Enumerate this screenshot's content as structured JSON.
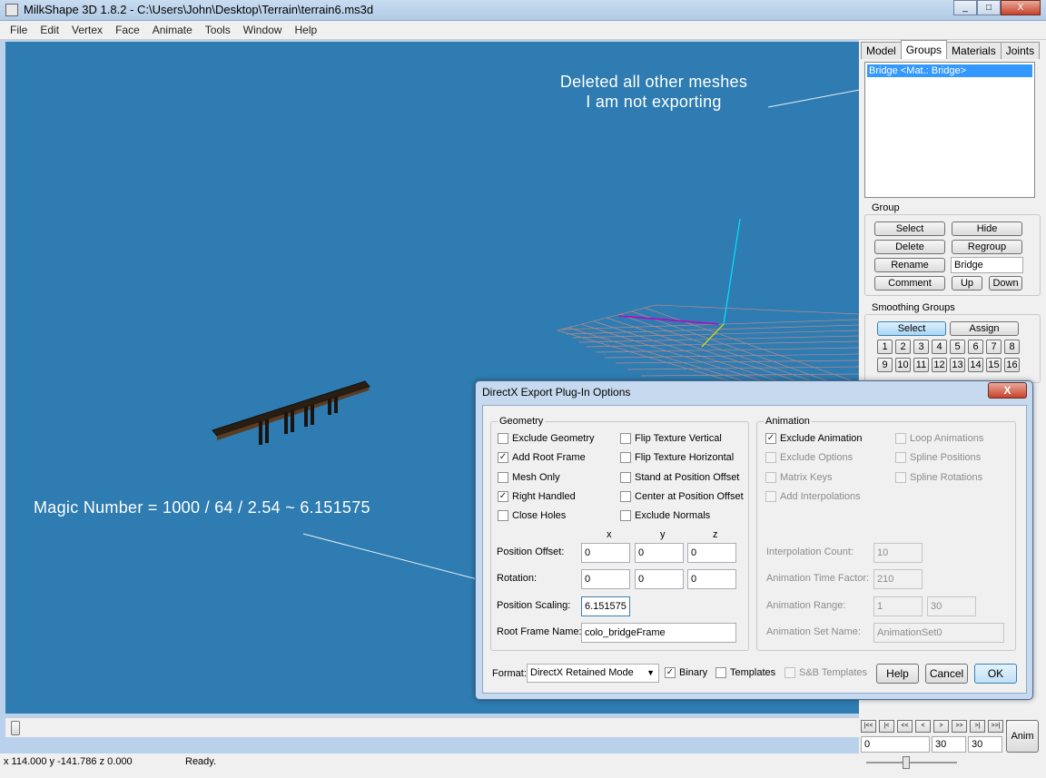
{
  "window": {
    "title": "MilkShape 3D 1.8.2 - C:\\Users\\John\\Desktop\\Terrain\\terrain6.ms3d",
    "buttons": [
      "_",
      "□",
      "X"
    ]
  },
  "menu": [
    "File",
    "Edit",
    "Vertex",
    "Face",
    "Animate",
    "Tools",
    "Window",
    "Help"
  ],
  "viewport": {
    "annotation_top": [
      "Deleted all other meshes",
      "I am not exporting"
    ],
    "annotation_left": "Magic Number = 1000 / 64 / 2.54 ~ 6.151575"
  },
  "right_panel": {
    "tabs": [
      "Model",
      "Groups",
      "Materials",
      "Joints"
    ],
    "active_tab": "Groups",
    "group_list": [
      "Bridge <Mat.: Bridge>"
    ],
    "group": {
      "title": "Group",
      "select": "Select",
      "hide": "Hide",
      "delete": "Delete",
      "regroup": "Regroup",
      "rename": "Rename",
      "name_value": "Bridge",
      "comment": "Comment",
      "up": "Up",
      "down": "Down"
    },
    "smoothing": {
      "title": "Smoothing Groups",
      "select": "Select",
      "assign": "Assign",
      "numbers": [
        "1",
        "2",
        "3",
        "4",
        "5",
        "6",
        "7",
        "8",
        "9",
        "10",
        "11",
        "12",
        "13",
        "14",
        "15",
        "16"
      ]
    }
  },
  "status": {
    "coords": "x 114.000 y -141.786 z 0.000",
    "message": "Ready."
  },
  "anim_controls": {
    "nav": [
      "|<<",
      "|<",
      "<<",
      "<",
      ">",
      ">>",
      ">|",
      ">>|",
      "||"
    ],
    "anim_button": "Anim",
    "frame": "0",
    "start": "30",
    "end": "30"
  },
  "dialog": {
    "title": "DirectX Export Plug-In Options",
    "close": "X",
    "geometry": {
      "title": "Geometry",
      "checks_left": [
        {
          "label": "Exclude Geometry",
          "checked": false
        },
        {
          "label": "Add Root Frame",
          "checked": true
        },
        {
          "label": "Mesh Only",
          "checked": false
        },
        {
          "label": "Right Handled",
          "checked": true
        },
        {
          "label": "Close Holes",
          "checked": false
        }
      ],
      "checks_right": [
        {
          "label": "Flip Texture Vertical",
          "checked": false
        },
        {
          "label": "Flip Texture Horizontal",
          "checked": false
        },
        {
          "label": "Stand at Position Offset",
          "checked": false
        },
        {
          "label": "Center at Position Offset",
          "checked": false
        },
        {
          "label": "Exclude Normals",
          "checked": false
        }
      ],
      "axis_x": "x",
      "axis_y": "y",
      "axis_z": "z",
      "position_offset_label": "Position Offset:",
      "position_offset": [
        "0",
        "0",
        "0"
      ],
      "rotation_label": "Rotation:",
      "rotation": [
        "0",
        "0",
        "0"
      ],
      "position_scaling_label": "Position Scaling:",
      "position_scaling": "6.151575",
      "root_frame_label": "Root Frame Name:",
      "root_frame": "colo_bridgeFrame"
    },
    "animation": {
      "title": "Animation",
      "checks_left": [
        {
          "label": "Exclude Animation",
          "checked": true,
          "enabled": true
        },
        {
          "label": "Exclude Options",
          "checked": false,
          "enabled": false
        },
        {
          "label": "Matrix Keys",
          "checked": false,
          "enabled": false
        },
        {
          "label": "Add Interpolations",
          "checked": false,
          "enabled": false
        }
      ],
      "checks_right": [
        {
          "label": "Loop Animations",
          "checked": false
        },
        {
          "label": "Spline Positions",
          "checked": false
        },
        {
          "label": "Spline Rotations",
          "checked": false
        }
      ],
      "interp_count_label": "Interpolation Count:",
      "interp_count": "10",
      "time_factor_label": "Animation Time Factor:",
      "time_factor": "210",
      "range_label": "Animation Range:",
      "range_start": "1",
      "range_end": "30",
      "set_name_label": "Animation Set Name:",
      "set_name": "AnimationSet0"
    },
    "format_label": "Format:",
    "format_value": "DirectX Retained Mode",
    "binary_label": "Binary",
    "binary_checked": true,
    "templates_label": "Templates",
    "templates_checked": false,
    "sb_templates_label": "S&B Templates",
    "help": "Help",
    "cancel": "Cancel",
    "ok": "OK"
  },
  "colors": {
    "viewport_bg": "#2e7cb1",
    "selection": "#3399ff",
    "grid": "#b98b8b"
  }
}
